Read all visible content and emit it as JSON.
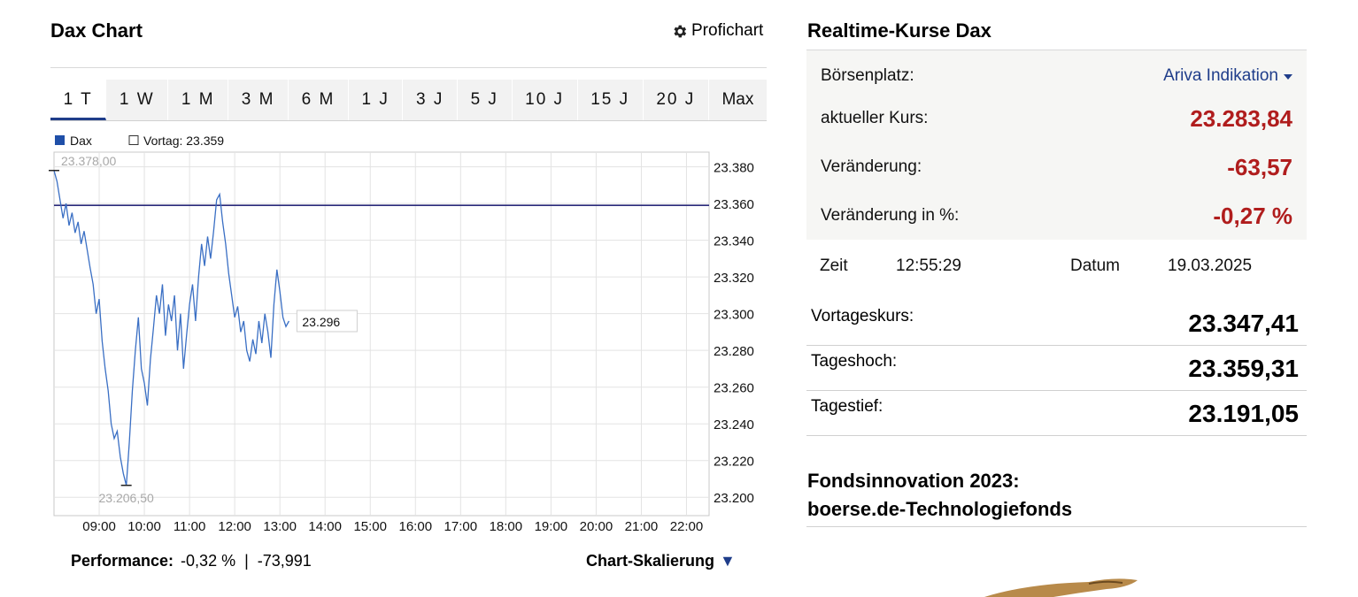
{
  "chart_panel": {
    "title": "Dax Chart",
    "prochart_label": "Profichart",
    "range_tabs": [
      {
        "label": "1 T",
        "active": true
      },
      {
        "label": "1 W",
        "active": false
      },
      {
        "label": "1 M",
        "active": false
      },
      {
        "label": "3 M",
        "active": false
      },
      {
        "label": "6 M",
        "active": false
      },
      {
        "label": "1 J",
        "active": false
      },
      {
        "label": "3 J",
        "active": false
      },
      {
        "label": "5 J",
        "active": false
      },
      {
        "label": "10 J",
        "active": false
      },
      {
        "label": "15 J",
        "active": false
      },
      {
        "label": "20 J",
        "active": false
      },
      {
        "label": "Max",
        "active": false
      }
    ],
    "performance_label": "Performance:",
    "performance_value": "-0,32 %  |  -73,991",
    "scaling_label": "Chart-Skalierung"
  },
  "chart_data": {
    "type": "line",
    "title": "",
    "xlabel": "",
    "ylabel": "",
    "ylim": [
      23190,
      23388
    ],
    "xlim": [
      "08:00",
      "22:30"
    ],
    "x_ticks": [
      "09:00",
      "10:00",
      "11:00",
      "12:00",
      "13:00",
      "14:00",
      "15:00",
      "16:00",
      "17:00",
      "18:00",
      "19:00",
      "20:00",
      "21:00",
      "22:00"
    ],
    "y_ticks": [
      "23.380",
      "23.360",
      "23.340",
      "23.320",
      "23.300",
      "23.280",
      "23.260",
      "23.240",
      "23.220",
      "23.200"
    ],
    "y_tick_values": [
      23380,
      23360,
      23340,
      23320,
      23300,
      23280,
      23260,
      23240,
      23220,
      23200
    ],
    "grid": true,
    "legend": [
      {
        "name": "Dax",
        "color": "#1f4fa8",
        "marker": "filled"
      },
      {
        "name": "Vortag: 23.359",
        "color": "#333333",
        "marker": "hollow"
      }
    ],
    "reference_line": {
      "value": 23359,
      "color": "#2a2a7a"
    },
    "high_label": "23.378,00",
    "high_value": 23378,
    "low_label": "23.206,50",
    "low_value": 23206.5,
    "last_label": "23.296",
    "last_value": 23296,
    "series": [
      {
        "name": "Dax",
        "color": "#3a6fc4",
        "points": [
          [
            "08:00",
            23378
          ],
          [
            "08:04",
            23372
          ],
          [
            "08:08",
            23362
          ],
          [
            "08:12",
            23352
          ],
          [
            "08:16",
            23360
          ],
          [
            "08:20",
            23348
          ],
          [
            "08:24",
            23355
          ],
          [
            "08:28",
            23344
          ],
          [
            "08:32",
            23350
          ],
          [
            "08:36",
            23338
          ],
          [
            "08:40",
            23345
          ],
          [
            "08:44",
            23335
          ],
          [
            "08:48",
            23325
          ],
          [
            "08:52",
            23316
          ],
          [
            "08:56",
            23300
          ],
          [
            "09:00",
            23308
          ],
          [
            "09:04",
            23285
          ],
          [
            "09:08",
            23270
          ],
          [
            "09:12",
            23258
          ],
          [
            "09:16",
            23240
          ],
          [
            "09:20",
            23232
          ],
          [
            "09:24",
            23236
          ],
          [
            "09:28",
            23222
          ],
          [
            "09:32",
            23213
          ],
          [
            "09:36",
            23206.5
          ],
          [
            "09:40",
            23230
          ],
          [
            "09:44",
            23258
          ],
          [
            "09:48",
            23280
          ],
          [
            "09:52",
            23298
          ],
          [
            "09:56",
            23270
          ],
          [
            "10:00",
            23262
          ],
          [
            "10:04",
            23250
          ],
          [
            "10:08",
            23275
          ],
          [
            "10:12",
            23292
          ],
          [
            "10:16",
            23310
          ],
          [
            "10:20",
            23300
          ],
          [
            "10:24",
            23316
          ],
          [
            "10:28",
            23288
          ],
          [
            "10:32",
            23305
          ],
          [
            "10:36",
            23296
          ],
          [
            "10:40",
            23310
          ],
          [
            "10:44",
            23280
          ],
          [
            "10:48",
            23300
          ],
          [
            "10:52",
            23270
          ],
          [
            "10:56",
            23288
          ],
          [
            "11:00",
            23305
          ],
          [
            "11:04",
            23316
          ],
          [
            "11:08",
            23296
          ],
          [
            "11:12",
            23320
          ],
          [
            "11:16",
            23338
          ],
          [
            "11:20",
            23326
          ],
          [
            "11:24",
            23342
          ],
          [
            "11:28",
            23330
          ],
          [
            "11:32",
            23345
          ],
          [
            "11:36",
            23362
          ],
          [
            "11:40",
            23365
          ],
          [
            "11:44",
            23350
          ],
          [
            "11:48",
            23338
          ],
          [
            "11:52",
            23322
          ],
          [
            "11:56",
            23310
          ],
          [
            "12:00",
            23298
          ],
          [
            "12:04",
            23304
          ],
          [
            "12:08",
            23290
          ],
          [
            "12:12",
            23296
          ],
          [
            "12:16",
            23280
          ],
          [
            "12:20",
            23274
          ],
          [
            "12:24",
            23286
          ],
          [
            "12:28",
            23278
          ],
          [
            "12:32",
            23296
          ],
          [
            "12:36",
            23284
          ],
          [
            "12:40",
            23300
          ],
          [
            "12:44",
            23290
          ],
          [
            "12:48",
            23276
          ],
          [
            "12:52",
            23305
          ],
          [
            "12:56",
            23324
          ],
          [
            "13:00",
            23312
          ],
          [
            "13:04",
            23298
          ],
          [
            "13:08",
            23293
          ],
          [
            "13:12",
            23296
          ]
        ]
      }
    ]
  },
  "quotes_panel": {
    "title": "Realtime-Kurse Dax",
    "exchange_label": "Börsenplatz:",
    "exchange_value": "Ariva Indikation",
    "price_label": "aktueller Kurs:",
    "price_value": "23.283,84",
    "change_label": "Veränderung:",
    "change_value": "-63,57",
    "change_pct_label": "Veränderung in %:",
    "change_pct_value": "-0,27 %",
    "time_label": "Zeit",
    "time_value": "12:55:29",
    "date_label": "Datum",
    "date_value": "19.03.2025",
    "stats": [
      {
        "label": "Vortageskurs:",
        "value": "23.347,41"
      },
      {
        "label": "Tageshoch:",
        "value": "23.359,31"
      },
      {
        "label": "Tagestief:",
        "value": "23.191,05"
      }
    ],
    "colors": {
      "negative": "#b01d1d",
      "link": "#1f3d8a"
    }
  },
  "promo": {
    "line1": "Fondsinnovation 2023:",
    "line2": "boerse.de-Technologiefonds"
  }
}
